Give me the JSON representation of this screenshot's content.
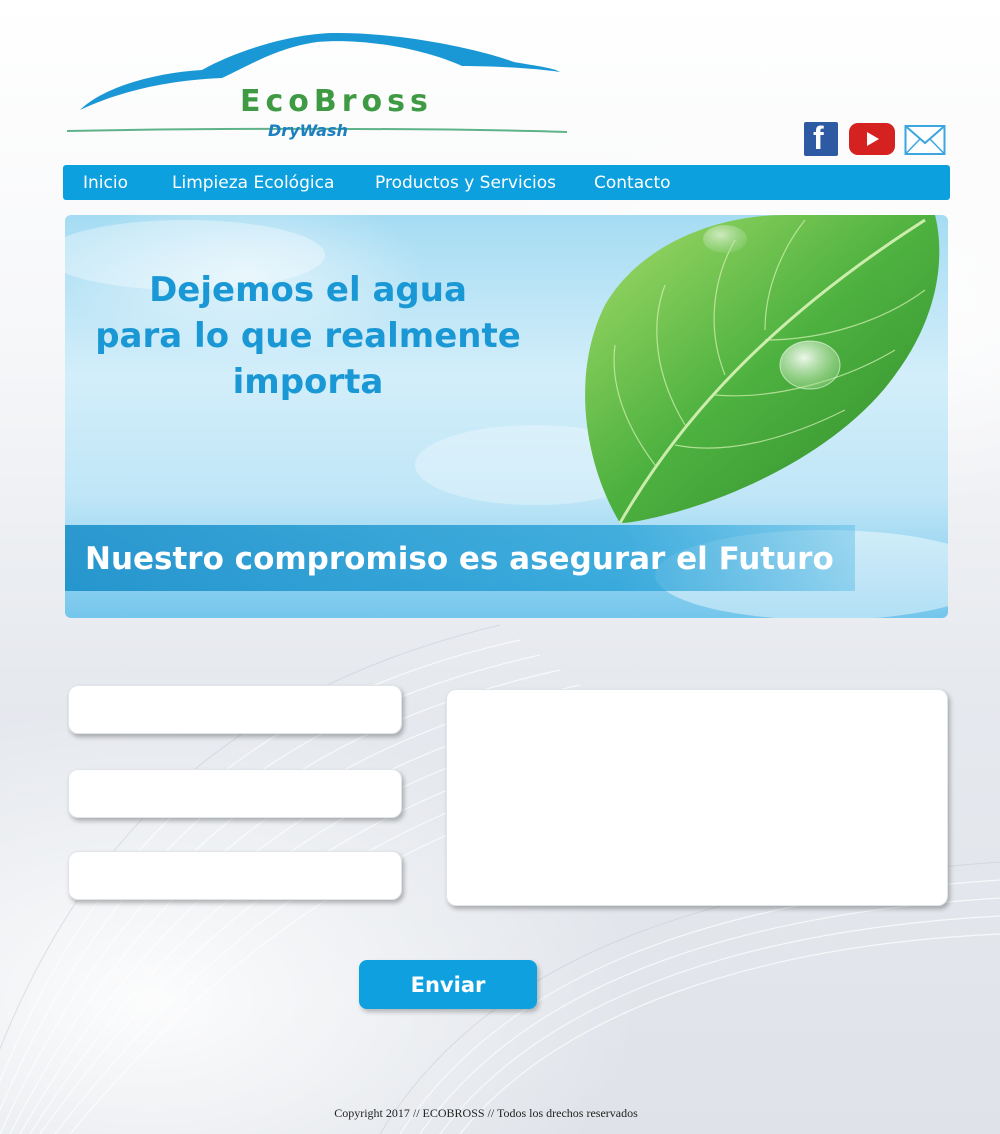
{
  "brand": {
    "name": "EcoBross",
    "tagline": "DryWash",
    "colors": {
      "swoosh": "#1a98d5",
      "name": "#3f9a44",
      "tagline": "#1b7fc0"
    }
  },
  "social": [
    {
      "icon": "facebook-icon",
      "label": "f"
    },
    {
      "icon": "youtube-icon"
    },
    {
      "icon": "mail-icon"
    }
  ],
  "nav": {
    "items": [
      {
        "label": "Inicio"
      },
      {
        "label": "Limpieza Ecológica"
      },
      {
        "label": "Productos y Servicios"
      },
      {
        "label": "Contacto"
      }
    ],
    "color": "#0da0df"
  },
  "hero": {
    "headline_lines": [
      "Dejemos el agua",
      "para lo que realmente",
      "importa"
    ],
    "band_text": "Nuestro compromiso es asegurar el Futuro"
  },
  "form": {
    "fields": [
      {
        "value": "",
        "placeholder": ""
      },
      {
        "value": "",
        "placeholder": ""
      },
      {
        "value": "",
        "placeholder": ""
      }
    ],
    "message": {
      "value": "",
      "placeholder": ""
    },
    "submit_label": "Enviar"
  },
  "footer": {
    "text": "Copyright 2017 // ECOBROSS // Todos los drechos reservados"
  }
}
